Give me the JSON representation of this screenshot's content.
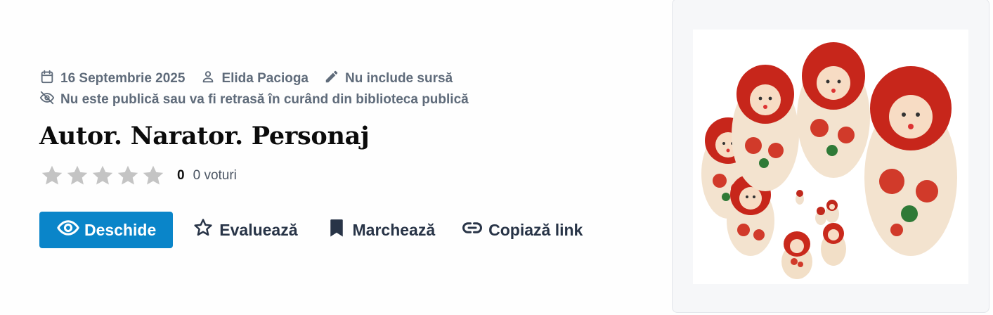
{
  "meta": {
    "date": "16 Septembrie 2025",
    "author": "Elida Pacioga",
    "source": "Nu include sursă",
    "visibility": "Nu este publică sau va fi retrasă în curând din biblioteca publică"
  },
  "title": "Autor. Narator. Personaj",
  "rating": {
    "stars_total": 5,
    "stars_filled": 0,
    "value": "0",
    "votes_count": "0",
    "votes_label": "voturi"
  },
  "actions": {
    "open_label": "Deschide",
    "rate_label": "Evaluează",
    "bookmark_label": "Marchează",
    "copy_link_label": "Copiază link"
  },
  "icons": {
    "date": "calendar-icon",
    "author": "user-icon",
    "source": "pencil-icon",
    "visibility": "eye-off-icon",
    "open": "eye-icon",
    "rate": "star-outline-icon",
    "bookmark": "bookmark-icon",
    "copy_link": "link-icon"
  },
  "colors": {
    "primary": "#0a85c9",
    "meta_text": "#5f6b7a",
    "star_empty": "#c4c4c4",
    "action_text": "#283447"
  }
}
